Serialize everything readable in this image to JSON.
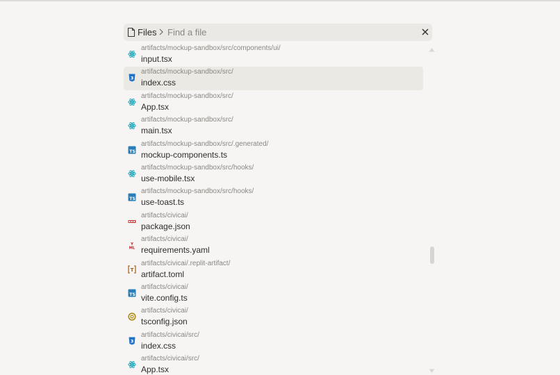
{
  "header": {
    "files_label": "Files",
    "search_placeholder": "Find a file"
  },
  "results": [
    {
      "path": "artifacts/mockup-sandbox/src/components/ui/",
      "name": "input.tsx",
      "icon": "react-icon"
    },
    {
      "path": "artifacts/mockup-sandbox/src/",
      "name": "index.css",
      "icon": "css-icon",
      "selected": true
    },
    {
      "path": "artifacts/mockup-sandbox/src/",
      "name": "App.tsx",
      "icon": "react-icon"
    },
    {
      "path": "artifacts/mockup-sandbox/src/",
      "name": "main.tsx",
      "icon": "react-icon"
    },
    {
      "path": "artifacts/mockup-sandbox/src/.generated/",
      "name": "mockup-components.ts",
      "icon": "typescript-icon"
    },
    {
      "path": "artifacts/mockup-sandbox/src/hooks/",
      "name": "use-mobile.tsx",
      "icon": "react-icon"
    },
    {
      "path": "artifacts/mockup-sandbox/src/hooks/",
      "name": "use-toast.ts",
      "icon": "typescript-icon"
    },
    {
      "path": "artifacts/civicai/",
      "name": "package.json",
      "icon": "npm-icon"
    },
    {
      "path": "artifacts/civicai/",
      "name": "requirements.yaml",
      "icon": "yaml-icon"
    },
    {
      "path": "artifacts/civicai/.replit-artifact/",
      "name": "artifact.toml",
      "icon": "toml-icon"
    },
    {
      "path": "artifacts/civicai/",
      "name": "vite.config.ts",
      "icon": "typescript-icon"
    },
    {
      "path": "artifacts/civicai/",
      "name": "tsconfig.json",
      "icon": "tsconfig-icon"
    },
    {
      "path": "artifacts/civicai/src/",
      "name": "index.css",
      "icon": "css-icon"
    },
    {
      "path": "artifacts/civicai/src/",
      "name": "App.tsx",
      "icon": "react-icon"
    }
  ],
  "colors": {
    "background": "#f6f5f3",
    "search_bar": "#ebe9e5",
    "selected_row": "#ebe9e4",
    "react": "#17a2b8",
    "css": "#1f73c7",
    "typescript": "#2a7db8",
    "npm": "#cb3837",
    "yaml": "#cb171e",
    "toml": "#a35c12",
    "tsconfig": "#b08a14"
  }
}
